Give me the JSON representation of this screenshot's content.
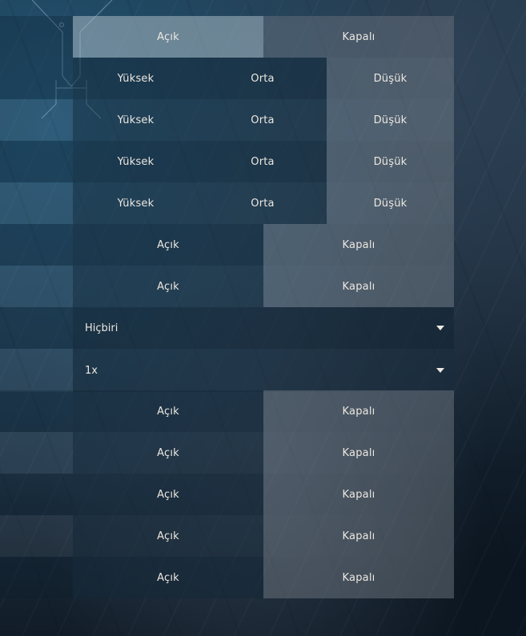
{
  "rows": [
    {
      "type": "binary",
      "options": [
        "Açık",
        "Kapalı"
      ],
      "selected": 0
    },
    {
      "type": "triple",
      "options": [
        "Yüksek",
        "Orta",
        "Düşük"
      ],
      "selected": 1
    },
    {
      "type": "triple",
      "options": [
        "Yüksek",
        "Orta",
        "Düşük"
      ],
      "selected": 1
    },
    {
      "type": "triple",
      "options": [
        "Yüksek",
        "Orta",
        "Düşük"
      ],
      "selected": 1
    },
    {
      "type": "triple",
      "options": [
        "Yüksek",
        "Orta",
        "Düşük"
      ],
      "selected": 1
    },
    {
      "type": "binary",
      "options": [
        "Açık",
        "Kapalı"
      ],
      "selected": 0
    },
    {
      "type": "binary",
      "options": [
        "Açık",
        "Kapalı"
      ],
      "selected": 0
    },
    {
      "type": "dropdown",
      "value": "Hiçbiri",
      "icon": "caret-down-icon"
    },
    {
      "type": "dropdown",
      "value": "1x",
      "icon": "caret-down-icon"
    },
    {
      "type": "binary",
      "options": [
        "Açık",
        "Kapalı"
      ],
      "selected": 0
    },
    {
      "type": "binary",
      "options": [
        "Açık",
        "Kapalı"
      ],
      "selected": 0
    },
    {
      "type": "binary",
      "options": [
        "Açık",
        "Kapalı"
      ],
      "selected": 0
    },
    {
      "type": "binary",
      "options": [
        "Açık",
        "Kapalı"
      ],
      "selected": 0
    },
    {
      "type": "binary",
      "options": [
        "Açık",
        "Kapalı"
      ],
      "selected": 0
    }
  ]
}
